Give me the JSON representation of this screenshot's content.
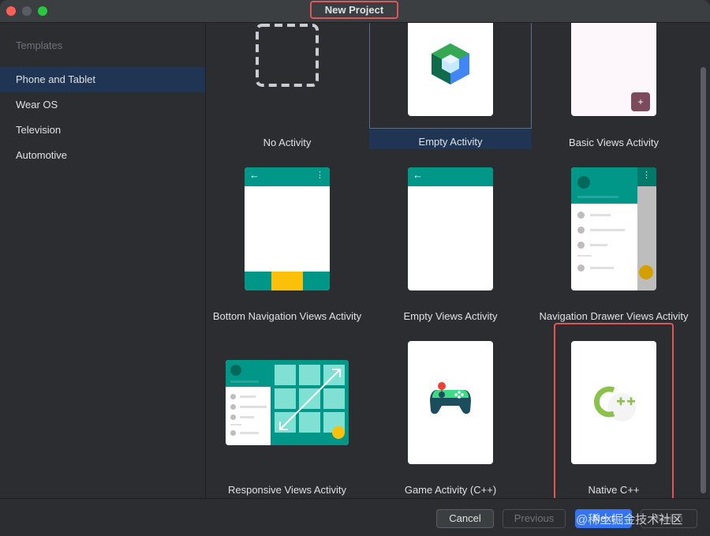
{
  "window": {
    "title": "New Project",
    "traffic_colors": [
      "#ff5f57",
      "#5a5d63",
      "#28c840"
    ]
  },
  "sidebar": {
    "header": "Templates",
    "items": [
      {
        "label": "Phone and Tablet",
        "selected": true
      },
      {
        "label": "Wear OS",
        "selected": false
      },
      {
        "label": "Television",
        "selected": false
      },
      {
        "label": "Automotive",
        "selected": false
      }
    ]
  },
  "templates": [
    {
      "label": "No Activity",
      "icon": "dashed-placeholder-icon"
    },
    {
      "label": "Empty Activity",
      "icon": "compose-hexagon-icon",
      "selected": true
    },
    {
      "label": "Basic Views Activity",
      "icon": "fab-plus-icon"
    },
    {
      "label": "Bottom Navigation Views Activity",
      "icon": "bottom-nav-icon"
    },
    {
      "label": "Empty Views Activity",
      "icon": "empty-views-icon"
    },
    {
      "label": "Navigation Drawer Views Activity",
      "icon": "nav-drawer-icon"
    },
    {
      "label": "Responsive Views Activity",
      "icon": "responsive-grid-icon"
    },
    {
      "label": "Game Activity (C++)",
      "icon": "gamepad-icon"
    },
    {
      "label": "Native C++",
      "icon": "cpp-logo-icon"
    }
  ],
  "footer": {
    "cancel": "Cancel",
    "previous": "Previous",
    "next": "Next",
    "finish": "Finish"
  },
  "watermark": "@稀土掘金技术社区",
  "colors": {
    "accent": "#3574f0",
    "selection": "#1f3553",
    "teal": "#009688",
    "highlight": "#e05555"
  }
}
